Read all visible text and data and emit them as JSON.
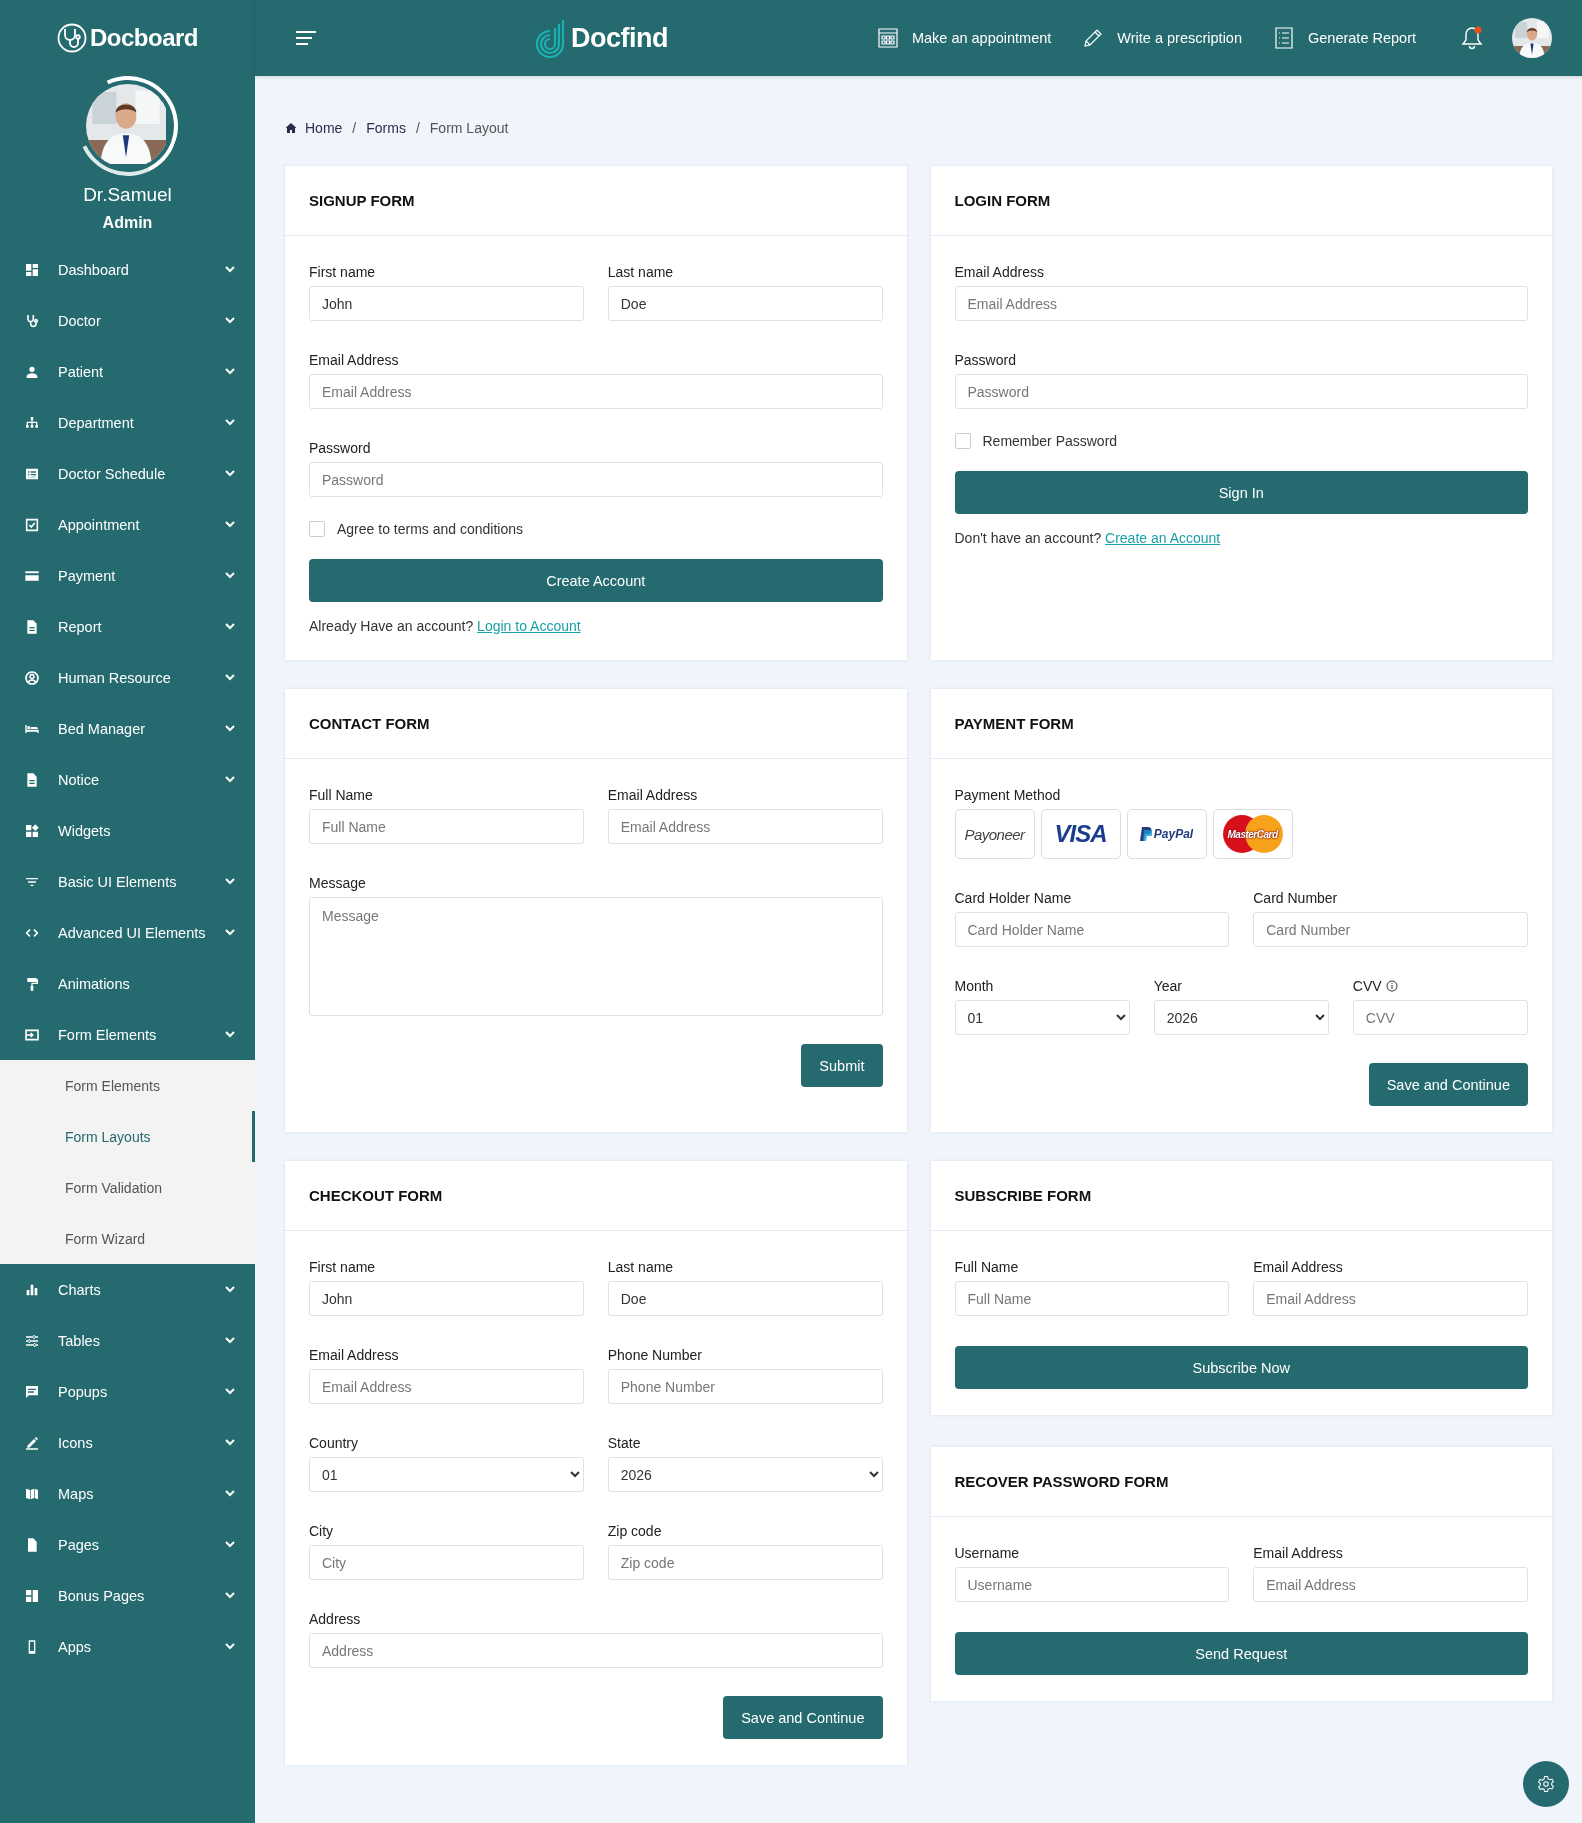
{
  "sidebar": {
    "brand": "Docboard",
    "profile": {
      "name": "Dr.Samuel",
      "role": "Admin"
    },
    "items": [
      {
        "label": "Dashboard",
        "expandable": true,
        "expanded": false
      },
      {
        "label": "Doctor",
        "expandable": true,
        "expanded": false
      },
      {
        "label": "Patient",
        "expandable": true,
        "expanded": false
      },
      {
        "label": "Department",
        "expandable": true,
        "expanded": false
      },
      {
        "label": "Doctor Schedule",
        "expandable": true,
        "expanded": false
      },
      {
        "label": "Appointment",
        "expandable": true,
        "expanded": false
      },
      {
        "label": "Payment",
        "expandable": true,
        "expanded": false
      },
      {
        "label": "Report",
        "expandable": true,
        "expanded": false
      },
      {
        "label": "Human Resource",
        "expandable": true,
        "expanded": false
      },
      {
        "label": "Bed Manager",
        "expandable": true,
        "expanded": false
      },
      {
        "label": "Notice",
        "expandable": true,
        "expanded": false
      },
      {
        "label": "Widgets",
        "expandable": false
      },
      {
        "label": "Basic UI Elements",
        "expandable": true,
        "expanded": false
      },
      {
        "label": "Advanced UI Elements",
        "expandable": true,
        "expanded": false
      },
      {
        "label": "Animations",
        "expandable": false
      },
      {
        "label": "Form Elements",
        "expandable": true,
        "expanded": true,
        "children": [
          {
            "label": "Form Elements",
            "selected": false
          },
          {
            "label": "Form Layouts",
            "selected": true
          },
          {
            "label": "Form Validation",
            "selected": false
          },
          {
            "label": "Form Wizard",
            "selected": false
          }
        ]
      },
      {
        "label": "Charts",
        "expandable": true,
        "expanded": false
      },
      {
        "label": "Tables",
        "expandable": true,
        "expanded": false
      },
      {
        "label": "Popups",
        "expandable": true,
        "expanded": false
      },
      {
        "label": "Icons",
        "expandable": true,
        "expanded": false
      },
      {
        "label": "Maps",
        "expandable": true,
        "expanded": false
      },
      {
        "label": "Pages",
        "expandable": true,
        "expanded": false
      },
      {
        "label": "Bonus Pages",
        "expandable": true,
        "expanded": false
      },
      {
        "label": "Apps",
        "expandable": true,
        "expanded": false
      }
    ]
  },
  "topbar": {
    "brand": "Docfind",
    "actions": [
      {
        "label": "Make an appointment"
      },
      {
        "label": "Write a prescription"
      },
      {
        "label": "Generate Report"
      }
    ],
    "notifications": {
      "unread": true
    }
  },
  "breadcrumb": [
    {
      "label": "Home",
      "current": false
    },
    {
      "separator": "/",
      "label": "Forms",
      "current": false
    },
    {
      "separator": "/",
      "label": "Form Layout",
      "current": true
    }
  ],
  "forms": [
    {
      "title": "SIGNUP FORM",
      "rows": [
        [
          {
            "kind": "input",
            "label": "First name",
            "value": "John"
          },
          {
            "kind": "input",
            "label": "Last name",
            "value": "Doe"
          }
        ],
        [
          {
            "kind": "input",
            "label": "Email Address",
            "placeholder": "Email Address"
          }
        ],
        [
          {
            "kind": "input",
            "label": "Password",
            "placeholder": "Password"
          }
        ],
        [
          {
            "kind": "checkbox",
            "label": "Agree to terms and conditions",
            "checked": false
          }
        ]
      ],
      "button": {
        "label": "Create Account",
        "kind": "block"
      },
      "footnote": {
        "text": "Already Have an account?",
        "link": "Login to Account"
      }
    },
    {
      "title": "LOGIN FORM",
      "rows": [
        [
          {
            "kind": "input",
            "label": "Email Address",
            "placeholder": "Email Address"
          }
        ],
        [
          {
            "kind": "input",
            "label": "Password",
            "placeholder": "Password"
          }
        ],
        [
          {
            "kind": "checkbox",
            "label": "Remember Password",
            "checked": false
          }
        ]
      ],
      "button": {
        "label": "Sign In",
        "kind": "block"
      },
      "footnote": {
        "text": "Don't have an account?",
        "link": "Create an Account"
      }
    },
    {
      "title": "CONTACT FORM",
      "rows": [
        [
          {
            "kind": "input",
            "label": "Full Name",
            "placeholder": "Full Name"
          },
          {
            "kind": "input",
            "label": "Email Address",
            "placeholder": "Email Address"
          }
        ],
        [
          {
            "kind": "textarea",
            "label": "Message",
            "placeholder": "Message"
          }
        ]
      ],
      "button": {
        "label": "Submit",
        "kind": "right"
      }
    },
    {
      "title": "PAYMENT FORM",
      "rows": [
        [
          {
            "kind": "methods",
            "label": "Payment Method",
            "options": [
              "Payoneer",
              "VISA",
              "PayPal",
              "MasterCard"
            ]
          }
        ],
        [
          {
            "kind": "input",
            "label": "Card Holder Name",
            "placeholder": "Card Holder Name"
          },
          {
            "kind": "input",
            "label": "Card Number",
            "placeholder": "Card Number"
          }
        ],
        [
          {
            "kind": "select",
            "label": "Month",
            "value": "01"
          },
          {
            "kind": "select",
            "label": "Year",
            "value": "2026"
          },
          {
            "kind": "input",
            "label": "CVV",
            "placeholder": "CVV",
            "info": true
          }
        ]
      ],
      "button": {
        "label": "Save and Continue",
        "kind": "right"
      }
    },
    {
      "title": "CHECKOUT FORM",
      "rows": [
        [
          {
            "kind": "input",
            "label": "First name",
            "value": "John"
          },
          {
            "kind": "input",
            "label": "Last name",
            "value": "Doe"
          }
        ],
        [
          {
            "kind": "input",
            "label": "Email Address",
            "placeholder": "Email Address"
          },
          {
            "kind": "input",
            "label": "Phone Number",
            "placeholder": "Phone Number"
          }
        ],
        [
          {
            "kind": "select",
            "label": "Country",
            "value": "01"
          },
          {
            "kind": "select",
            "label": "State",
            "value": "2026"
          }
        ],
        [
          {
            "kind": "input",
            "label": "City",
            "placeholder": "City"
          },
          {
            "kind": "input",
            "label": "Zip code",
            "placeholder": "Zip code"
          }
        ],
        [
          {
            "kind": "input",
            "label": "Address",
            "placeholder": "Address"
          }
        ]
      ],
      "button": {
        "label": "Save and Continue",
        "kind": "right"
      }
    },
    {
      "title": "SUBSCRIBE FORM",
      "rows": [
        [
          {
            "kind": "input",
            "label": "Full Name",
            "placeholder": "Full Name"
          },
          {
            "kind": "input",
            "label": "Email Address",
            "placeholder": "Email Address"
          }
        ]
      ],
      "button": {
        "label": "Subscribe Now",
        "kind": "block"
      }
    },
    {
      "title": "RECOVER PASSWORD FORM",
      "rows": [
        [
          {
            "kind": "input",
            "label": "Username",
            "placeholder": "Username"
          },
          {
            "kind": "input",
            "label": "Email Address",
            "placeholder": "Email Address"
          }
        ]
      ],
      "button": {
        "label": "Send Request",
        "kind": "block"
      }
    }
  ]
}
